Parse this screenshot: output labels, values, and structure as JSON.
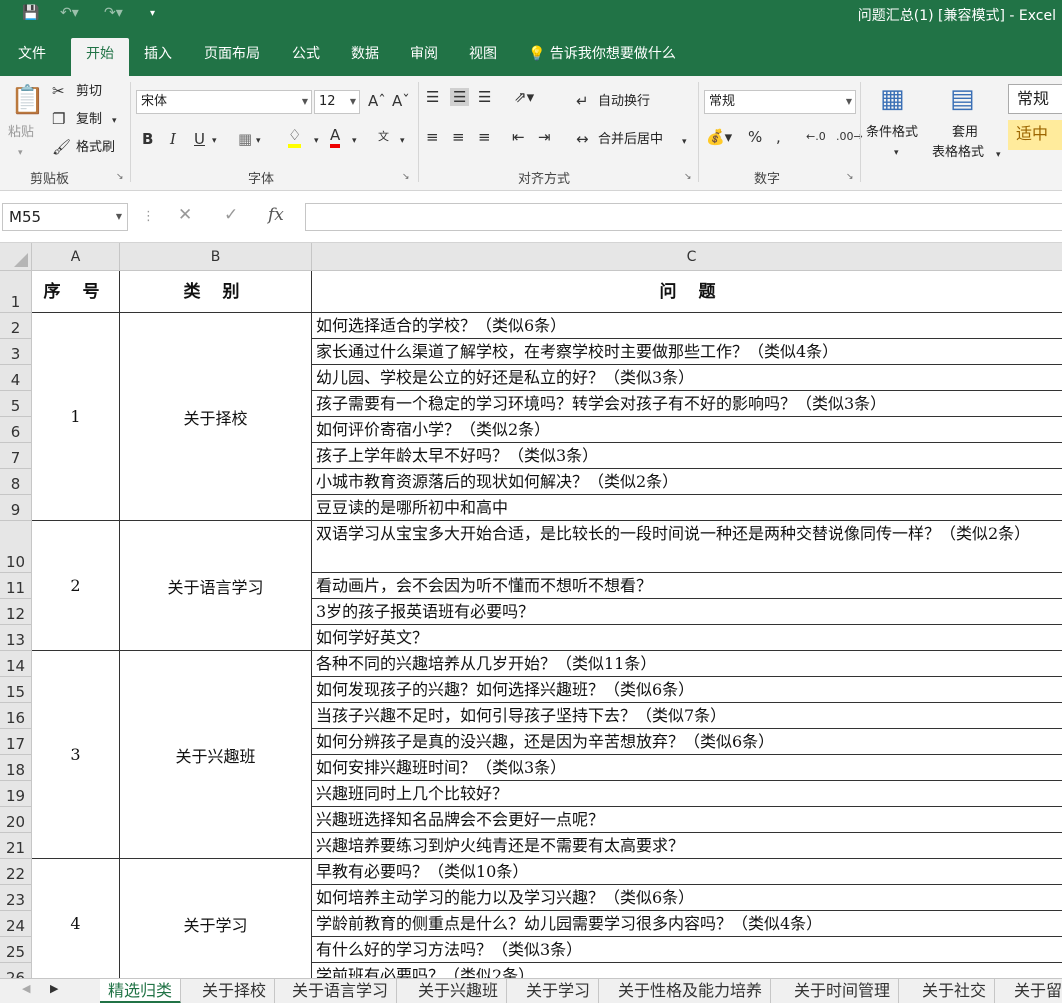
{
  "window": {
    "title": "问题汇总(1)  [兼容模式]  -  Excel"
  },
  "tabs": [
    "文件",
    "开始",
    "插入",
    "页面布局",
    "公式",
    "数据",
    "审阅",
    "视图"
  ],
  "tell_me": "告诉我你想要做什么",
  "ribbon": {
    "clipboard": {
      "paste": "粘贴",
      "cut": "剪切",
      "copy": "复制",
      "format_painter": "格式刷",
      "label": "剪贴板"
    },
    "font": {
      "name": "宋体",
      "size": "12",
      "bold": "B",
      "italic": "I",
      "underline": "U",
      "label": "字体"
    },
    "alignment": {
      "wrap_text": "自动换行",
      "merge_center": "合并后居中",
      "label": "对齐方式"
    },
    "number": {
      "format": "常规",
      "label": "数字"
    },
    "styles": {
      "conditional": "条件格式",
      "table_format_1": "套用",
      "table_format_2": "表格格式",
      "style_normal": "常规",
      "style_neutral": "适中"
    }
  },
  "formula_bar": {
    "name_box": "M55",
    "value": ""
  },
  "columns": [
    "A",
    "B",
    "C"
  ],
  "rows": [
    "1",
    "2",
    "3",
    "4",
    "5",
    "6",
    "7",
    "8",
    "9",
    "10",
    "11",
    "12",
    "13",
    "14",
    "15",
    "16",
    "17",
    "18",
    "19",
    "20",
    "21",
    "22",
    "23",
    "24",
    "25",
    "26"
  ],
  "table": {
    "headers": {
      "a": "序 号",
      "b": "类 别",
      "c": "问 题"
    },
    "groups": [
      {
        "num": "1",
        "category": "关于择校"
      },
      {
        "num": "2",
        "category": "关于语言学习"
      },
      {
        "num": "3",
        "category": "关于兴趣班"
      },
      {
        "num": "4",
        "category": "关于学习"
      }
    ],
    "questions": [
      "如何选择适合的学校？（类似6条）",
      "家长通过什么渠道了解学校，在考察学校时主要做那些工作？（类似4条）",
      "幼儿园、学校是公立的好还是私立的好？（类似3条）",
      "孩子需要有一个稳定的学习环境吗？转学会对孩子有不好的影响吗？（类似3条）",
      "如何评价寄宿小学？（类似2条）",
      "孩子上学年龄太早不好吗？（类似3条）",
      "小城市教育资源落后的现状如何解决？（类似2条）",
      "豆豆读的是哪所初中和高中",
      "双语学习从宝宝多大开始合适，是比较长的一段时间说一种还是两种交替说像同传一样？（类似2条）",
      "看动画片，会不会因为听不懂而不想听不想看？",
      "3岁的孩子报英语班有必要吗？",
      "如何学好英文？",
      "各种不同的兴趣培养从几岁开始？（类似11条）",
      "如何发现孩子的兴趣？如何选择兴趣班？（类似6条）",
      "当孩子兴趣不足时，如何引导孩子坚持下去？（类似7条）",
      "如何分辨孩子是真的没兴趣，还是因为辛苦想放弃？（类似6条）",
      "如何安排兴趣班时间？（类似3条）",
      "兴趣班同时上几个比较好？",
      "兴趣班选择知名品牌会不会更好一点呢？",
      "兴趣培养要练习到炉火纯青还是不需要有太高要求？",
      "早教有必要吗？（类似10条）",
      "如何培养主动学习的能力以及学习兴趣？（类似6条）",
      "学龄前教育的侧重点是什么？幼儿园需要学习很多内容吗？（类似4条）",
      "有什么好的学习方法吗？（类似3条）",
      "学前班有必要吗？（类似2条）"
    ]
  },
  "sheet_tabs": [
    "精选归类",
    "关于择校",
    "关于语言学习",
    "关于兴趣班",
    "关于学习",
    "关于性格及能力培养",
    "关于时间管理",
    "关于社交",
    "关于留"
  ]
}
